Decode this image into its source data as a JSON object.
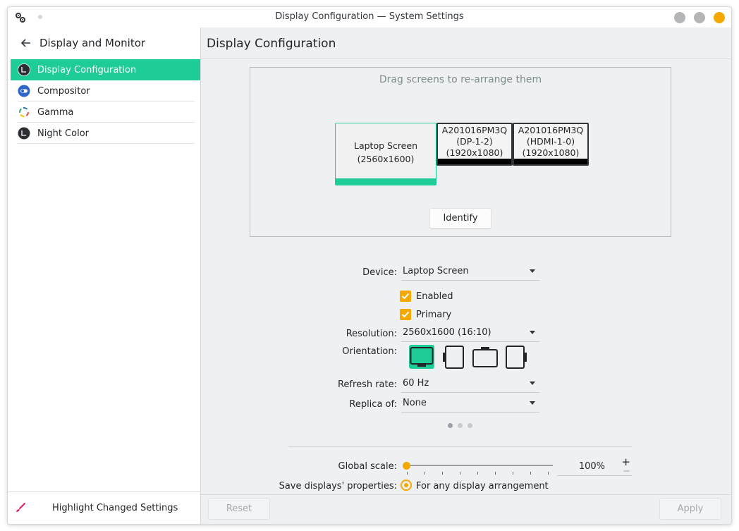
{
  "window": {
    "title": "Display Configuration — System Settings"
  },
  "sidebar": {
    "back_label": "Display and Monitor",
    "items": [
      {
        "label": "Display Configuration",
        "icon": "display-icon",
        "active": true
      },
      {
        "label": "Compositor",
        "icon": "compositor-icon",
        "active": false
      },
      {
        "label": "Gamma",
        "icon": "gamma-icon",
        "active": false
      },
      {
        "label": "Night Color",
        "icon": "night-color-icon",
        "active": false
      }
    ],
    "footer_label": "Highlight Changed Settings"
  },
  "main": {
    "title": "Display Configuration",
    "arrange_hint": "Drag screens to re-arrange them",
    "screens": [
      {
        "name": "Laptop Screen",
        "resolution": "(2560x1600)",
        "primary": true
      },
      {
        "name": "A201016PM3Q",
        "connector": "(DP-1-2)",
        "resolution": "(1920x1080)",
        "primary": false
      },
      {
        "name": "A201016PM3Q",
        "connector": "(HDMI-1-0)",
        "resolution": "(1920x1080)",
        "primary": false
      }
    ],
    "identify_label": "Identify"
  },
  "form": {
    "device_label": "Device:",
    "device_value": "Laptop Screen",
    "enabled_label": "Enabled",
    "enabled": true,
    "primary_label": "Primary",
    "primary": true,
    "resolution_label": "Resolution:",
    "resolution_value": "2560x1600 (16:10)",
    "orientation_label": "Orientation:",
    "orientation_options": [
      "landscape",
      "portrait-left",
      "landscape-flipped",
      "portrait-right"
    ],
    "orientation_selected": "landscape",
    "refresh_label": "Refresh rate:",
    "refresh_value": "60 Hz",
    "replica_label": "Replica of:",
    "replica_value": "None",
    "page_count": 3,
    "page_current": 1,
    "scale_label": "Global scale:",
    "scale_value": "100%",
    "scale_percent": 100,
    "save_label": "Save displays' properties:",
    "save_option": "For any display arrangement"
  },
  "footer": {
    "reset_label": "Reset",
    "apply_label": "Apply"
  },
  "colors": {
    "accent": "#1dcc96",
    "highlight": "#f5a800",
    "close_button": "#f5a800"
  }
}
